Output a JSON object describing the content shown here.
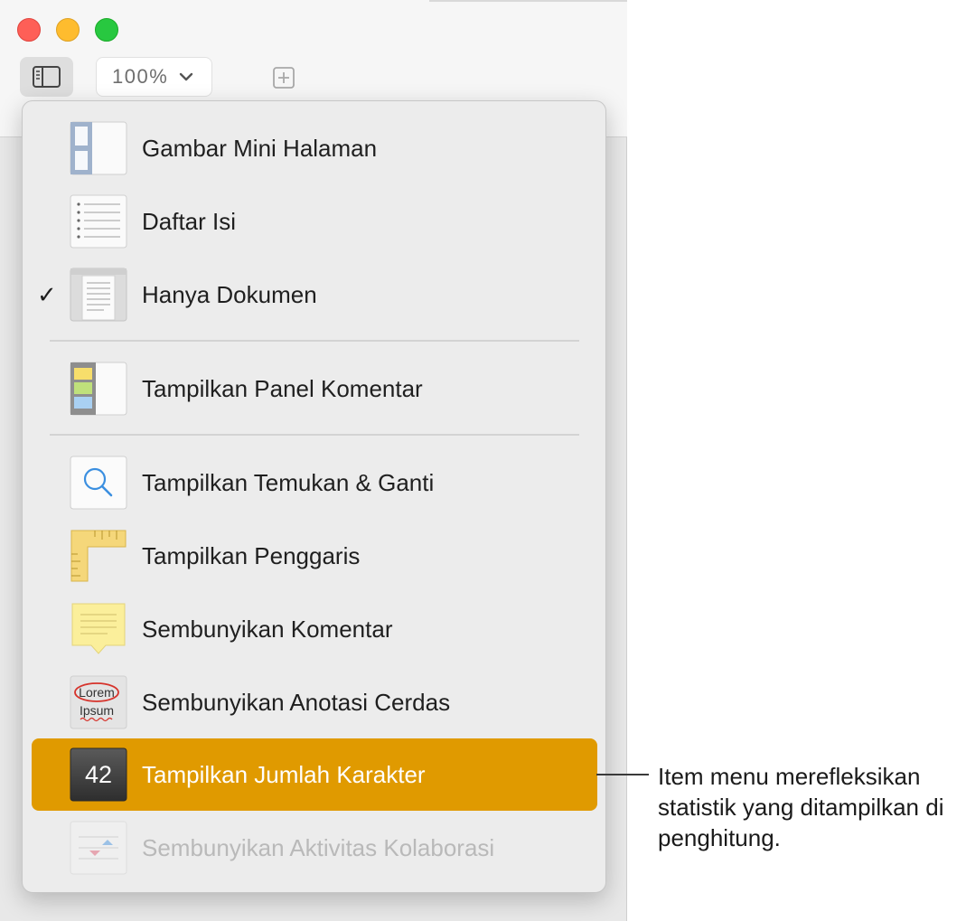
{
  "toolbar": {
    "zoom_label": "100%"
  },
  "menu": {
    "items": [
      {
        "label": "Gambar Mini Halaman",
        "icon": "page-thumbnails-icon"
      },
      {
        "label": "Daftar Isi",
        "icon": "table-of-contents-icon"
      },
      {
        "label": "Hanya Dokumen",
        "icon": "document-only-icon",
        "checked": true,
        "check_mark": "✓"
      },
      {
        "label": "Tampilkan Panel Komentar",
        "icon": "comments-pane-icon"
      },
      {
        "label": "Tampilkan Temukan & Ganti",
        "icon": "magnifier-icon"
      },
      {
        "label": "Tampilkan Penggaris",
        "icon": "ruler-icon"
      },
      {
        "label": "Sembunyikan Komentar",
        "icon": "sticky-note-icon"
      },
      {
        "label": "Sembunyikan Anotasi Cerdas",
        "icon": "smart-annotation-icon",
        "icon_text": [
          "Lorem",
          "Ipsum"
        ]
      },
      {
        "label": "Tampilkan Jumlah Karakter",
        "icon": "character-count-icon",
        "icon_text": "42",
        "highlighted": true
      },
      {
        "label": "Sembunyikan Aktivitas Kolaborasi",
        "icon": "collaboration-activity-icon",
        "disabled": true
      }
    ]
  },
  "callout": {
    "text": "Item menu merefleksikan statistik yang ditampilkan di penghitung."
  },
  "colors": {
    "highlight": "#e09a00",
    "close": "#fe5f57",
    "minimize": "#febc2e",
    "zoom": "#28c840"
  }
}
